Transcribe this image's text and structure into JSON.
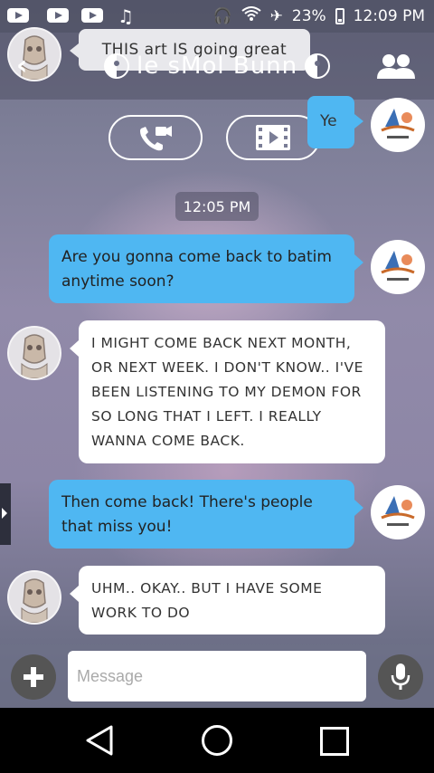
{
  "status_bar": {
    "battery_text": "23%",
    "time": "12:09 PM"
  },
  "header": {
    "tooltip": "THIS art IS going great",
    "title": "le sMol Bunn"
  },
  "call": {
    "voice_icon": "phone-camera-icon",
    "video_icon": "video-icon"
  },
  "messages": {
    "top_sent": "Ye",
    "timestamp": "12:05 PM",
    "m1": "Are you gonna come back to batim anytime soon?",
    "m2": "I MIGHT COME BACK NEXT MONTH, OR NEXT WEEK.  I DON'T KNOW.. I'VE BEEN LISTENING TO MY DEMON FOR SO LONG THAT I LEFT. I REALLY WANNA COME BACK.",
    "m3": "Then come back! There's people that miss you!",
    "m4": "UHM..  OKAY.. BUT I HAVE SOME WORK TO DO"
  },
  "input": {
    "placeholder": "Message"
  },
  "colors": {
    "outgoing_bubble": "#4fb7f2",
    "incoming_bubble": "#ffffff"
  }
}
